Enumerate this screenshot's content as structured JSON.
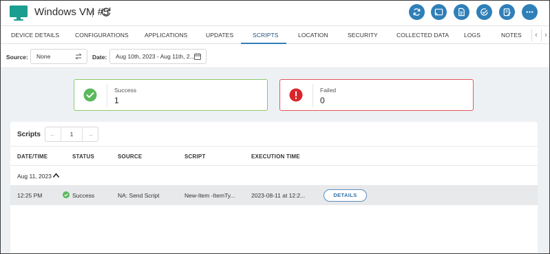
{
  "header": {
    "title": "Windows VM #5",
    "actions": [
      {
        "icon": "sync-icon"
      },
      {
        "icon": "cast-icon"
      },
      {
        "icon": "document-icon"
      },
      {
        "icon": "check-circle-icon"
      },
      {
        "icon": "clipboard-edit-icon"
      },
      {
        "icon": "more-icon"
      }
    ],
    "accent_color": "#2f7fb8"
  },
  "tabs": [
    {
      "label": "DEVICE DETAILS"
    },
    {
      "label": "CONFIGURATIONS"
    },
    {
      "label": "APPLICATIONS"
    },
    {
      "label": "UPDATES"
    },
    {
      "label": "SCRIPTS",
      "active": true
    },
    {
      "label": "LOCATION"
    },
    {
      "label": "SECURITY"
    },
    {
      "label": "COLLECTED DATA"
    },
    {
      "label": "LOGS"
    },
    {
      "label": "NOTES"
    }
  ],
  "filters": {
    "source_label": "Source:",
    "source_value": "None",
    "date_label": "Date:",
    "date_value": "Aug 10th, 2023 - Aug 11th, 2..."
  },
  "summary": {
    "success": {
      "label": "Success",
      "count": "1",
      "color": "#5cb85c"
    },
    "failed": {
      "label": "Failed",
      "count": "0",
      "color": "#d9262c"
    }
  },
  "scripts": {
    "title": "Scripts",
    "page": "1",
    "columns": [
      "DATE/TIME",
      "STATUS",
      "SOURCE",
      "SCRIPT",
      "EXECUTION TIME"
    ],
    "group_label": "Aug 11, 2023",
    "rows": [
      {
        "time": "12:25 PM",
        "status": "Success",
        "source": "NA: Send Script",
        "script": "New-Item -ItemTy...",
        "execution_time": "2023-08-11 at 12:2...",
        "action_label": "DETAILS"
      }
    ]
  }
}
